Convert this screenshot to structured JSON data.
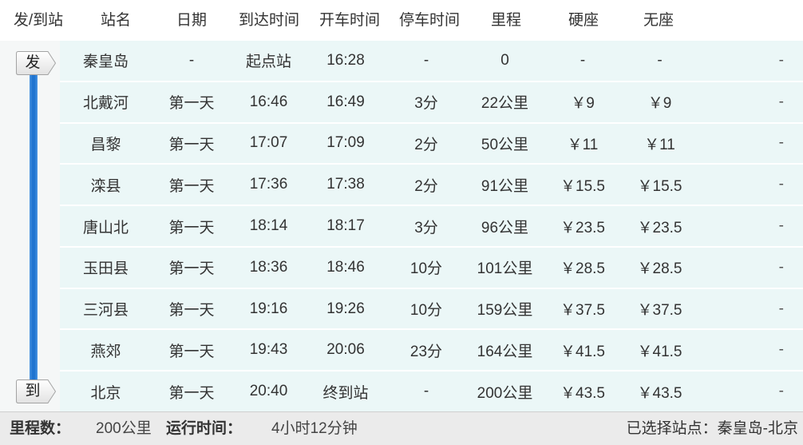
{
  "header": {
    "columns": [
      "发/到站",
      "站名",
      "日期",
      "到达时间",
      "开车时间",
      "停车时间",
      "里程",
      "硬座",
      "无座"
    ]
  },
  "route": {
    "depart_badge": "发",
    "arrive_badge": "到"
  },
  "rows": [
    {
      "station": "秦皇岛",
      "date": "-",
      "arrive": "起点站",
      "depart": "16:28",
      "stop": "-",
      "mileage": "0",
      "hard_seat": "-",
      "no_seat": "-",
      "extra": "-"
    },
    {
      "station": "北戴河",
      "date": "第一天",
      "arrive": "16:46",
      "depart": "16:49",
      "stop": "3分",
      "mileage": "22公里",
      "hard_seat": "￥9",
      "no_seat": "￥9",
      "extra": "-"
    },
    {
      "station": "昌黎",
      "date": "第一天",
      "arrive": "17:07",
      "depart": "17:09",
      "stop": "2分",
      "mileage": "50公里",
      "hard_seat": "￥11",
      "no_seat": "￥11",
      "extra": "-"
    },
    {
      "station": "滦县",
      "date": "第一天",
      "arrive": "17:36",
      "depart": "17:38",
      "stop": "2分",
      "mileage": "91公里",
      "hard_seat": "￥15.5",
      "no_seat": "￥15.5",
      "extra": "-"
    },
    {
      "station": "唐山北",
      "date": "第一天",
      "arrive": "18:14",
      "depart": "18:17",
      "stop": "3分",
      "mileage": "96公里",
      "hard_seat": "￥23.5",
      "no_seat": "￥23.5",
      "extra": "-"
    },
    {
      "station": "玉田县",
      "date": "第一天",
      "arrive": "18:36",
      "depart": "18:46",
      "stop": "10分",
      "mileage": "101公里",
      "hard_seat": "￥28.5",
      "no_seat": "￥28.5",
      "extra": "-"
    },
    {
      "station": "三河县",
      "date": "第一天",
      "arrive": "19:16",
      "depart": "19:26",
      "stop": "10分",
      "mileage": "159公里",
      "hard_seat": "￥37.5",
      "no_seat": "￥37.5",
      "extra": "-"
    },
    {
      "station": "燕郊",
      "date": "第一天",
      "arrive": "19:43",
      "depart": "20:06",
      "stop": "23分",
      "mileage": "164公里",
      "hard_seat": "￥41.5",
      "no_seat": "￥41.5",
      "extra": "-"
    },
    {
      "station": "北京",
      "date": "第一天",
      "arrive": "20:40",
      "depart": "终到站",
      "stop": "-",
      "mileage": "200公里",
      "hard_seat": "￥43.5",
      "no_seat": "￥43.5",
      "extra": "-"
    }
  ],
  "footer": {
    "mileage_label": "里程数：",
    "mileage_value": "200公里",
    "runtime_label": "运行时间：",
    "runtime_value": "4小时12分钟",
    "selected_label": "已选择站点：",
    "selected_value": "秦皇岛-北京"
  },
  "colors": {
    "route_line": "#1f74d0",
    "row_bg": "#ebf7f7",
    "route_col_bg": "#f5f7f7",
    "footer_bg": "#ebebeb"
  }
}
